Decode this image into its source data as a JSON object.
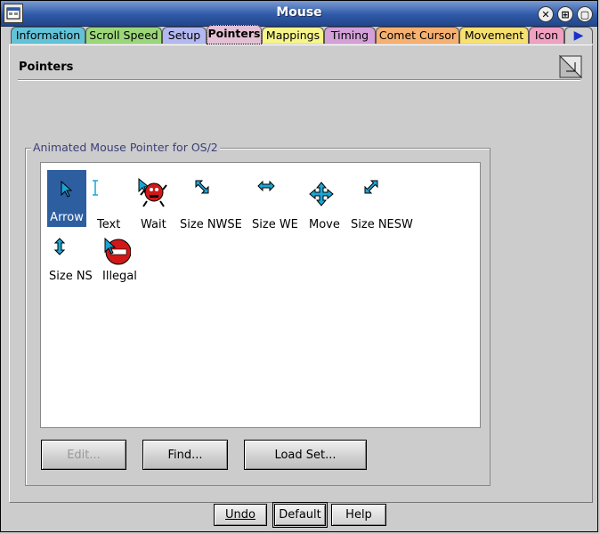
{
  "window": {
    "title": "Mouse",
    "close_glyph": "✕",
    "restore_glyph": "⊞",
    "minimize_glyph": "▢"
  },
  "tabs": [
    {
      "label": "Information",
      "color": "#62c3d8"
    },
    {
      "label": "Scroll Speed",
      "color": "#9bd77a"
    },
    {
      "label": "Setup",
      "color": "#b4b8f0"
    },
    {
      "label": "Pointers",
      "color": "#e4c0d4",
      "selected": true
    },
    {
      "label": "Mappings",
      "color": "#f6f48a"
    },
    {
      "label": "Timing",
      "color": "#d4a0d8"
    },
    {
      "label": "Comet Cursor",
      "color": "#f6b070"
    },
    {
      "label": "Movement",
      "color": "#f6e070"
    },
    {
      "label": "Icon",
      "color": "#f0a0c0"
    }
  ],
  "tab_scroll_glyph": "▶",
  "page": {
    "title": "Pointers"
  },
  "group": {
    "label": "Animated Mouse Pointer for OS/2"
  },
  "pointers": [
    {
      "label": "Arrow",
      "selected": true
    },
    {
      "label": "Text"
    },
    {
      "label": "Wait"
    },
    {
      "label": "Size NWSE"
    },
    {
      "label": "Size WE"
    },
    {
      "label": "Move"
    },
    {
      "label": "Size NESW"
    },
    {
      "label": "Size NS"
    },
    {
      "label": "Illegal"
    }
  ],
  "buttons": {
    "edit": "Edit...",
    "find": "Find...",
    "load_set": "Load Set..."
  },
  "footer": {
    "undo": "Undo",
    "default": "Default",
    "help": "Help"
  },
  "colors": {
    "accent_cyan": "#1aa6d6",
    "selection": "#2d5ea0",
    "illegal_red": "#d01818"
  }
}
